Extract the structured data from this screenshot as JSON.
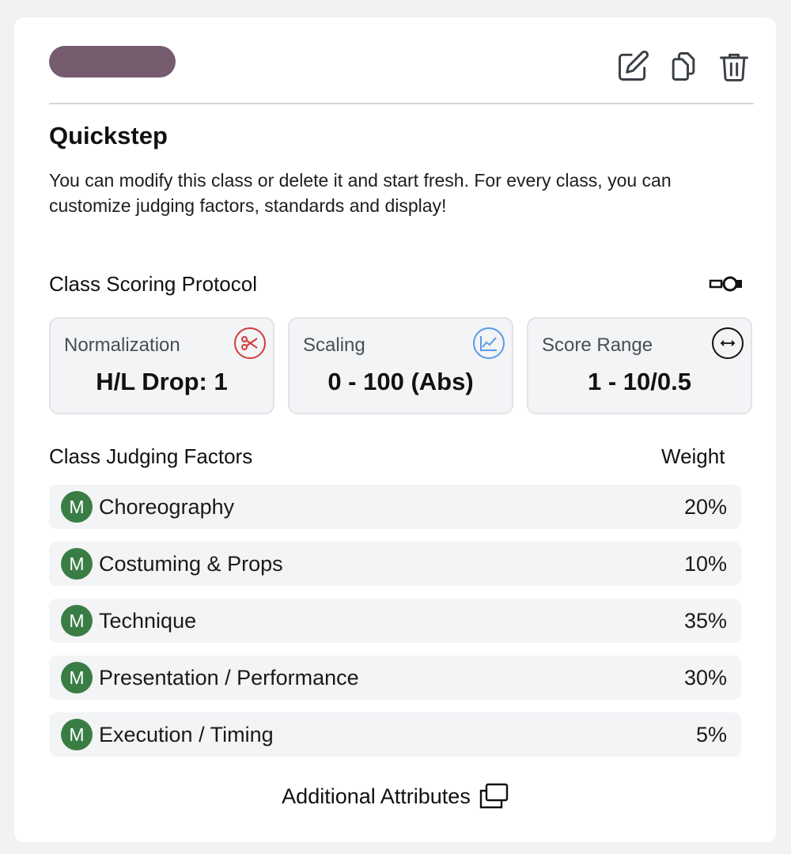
{
  "colors": {
    "class_color": "#755c6e",
    "badge": "#3a7d44",
    "normalization_icon": "#d23b3b",
    "scaling_icon": "#5b9be6",
    "range_icon": "#111111"
  },
  "class": {
    "title": "Quickstep",
    "description": "You can modify this class or delete it and start fresh. For every class, you can customize judging factors, standards and display!"
  },
  "toolbar": {
    "icons": [
      "edit-icon",
      "copy-icon",
      "trash-icon"
    ]
  },
  "scoring": {
    "label": "Class Scoring Protocol",
    "cards": [
      {
        "label": "Normalization",
        "value": "H/L Drop: 1",
        "icon": "scissors-icon"
      },
      {
        "label": "Scaling",
        "value": "0 - 100 (Abs)",
        "icon": "chart-icon"
      },
      {
        "label": "Score Range",
        "value": "1 - 10/0.5",
        "icon": "arrows-horizontal-icon"
      }
    ]
  },
  "factors": {
    "label": "Class Judging Factors",
    "weight_label": "Weight",
    "items": [
      {
        "badge": "M",
        "name": "Choreography",
        "weight": "20%"
      },
      {
        "badge": "M",
        "name": "Costuming & Props",
        "weight": "10%"
      },
      {
        "badge": "M",
        "name": "Technique",
        "weight": "35%"
      },
      {
        "badge": "M",
        "name": "Presentation / Performance",
        "weight": "30%"
      },
      {
        "badge": "M",
        "name": "Execution / Timing",
        "weight": "5%"
      }
    ]
  },
  "additional": {
    "label": "Additional Attributes"
  }
}
